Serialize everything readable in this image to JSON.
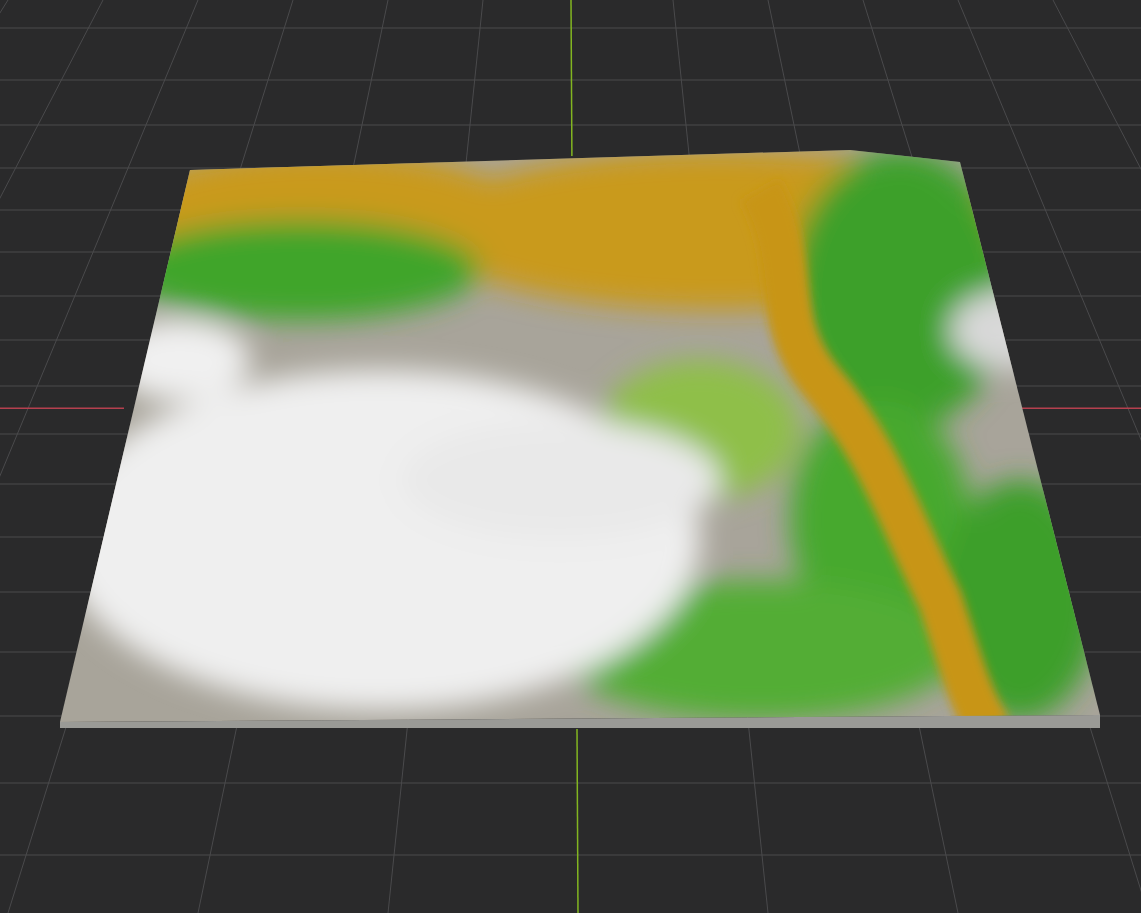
{
  "viewport": {
    "axes": [
      {
        "kind": "x",
        "color": "#b5404f"
      },
      {
        "kind": "y",
        "color": "#82b520"
      }
    ]
  }
}
